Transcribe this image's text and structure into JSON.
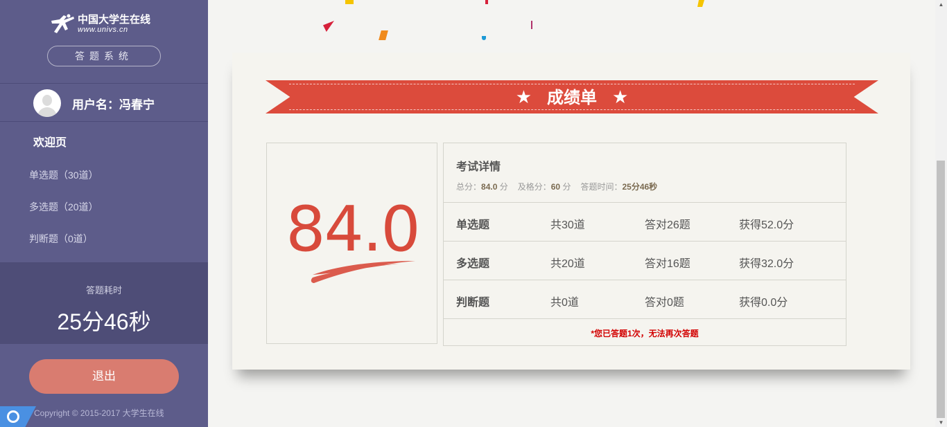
{
  "sidebar": {
    "logo_cn": "中国大学生在线",
    "logo_url": "www.univs.cn",
    "system_label": "答题系统",
    "username_label": "用户名：冯春宁",
    "nav": {
      "welcome": "欢迎页",
      "items": [
        {
          "label": "单选题（30道）"
        },
        {
          "label": "多选题（20道）"
        },
        {
          "label": "判断题（0道）"
        }
      ]
    },
    "timer_label": "答题耗时",
    "timer_value": "25分46秒",
    "logout_label": "退出",
    "copyright": "Copyright © 2015-2017 大学生在线"
  },
  "report": {
    "ribbon_title": "成绩单",
    "score": "84.0",
    "details_title": "考试详情",
    "total_label": "总分：",
    "total_value": "84.0",
    "total_unit": "分",
    "pass_label": "及格分：",
    "pass_value": "60",
    "pass_unit": "分",
    "time_label": "答题时间：",
    "time_value": "25分46秒",
    "rows": [
      {
        "type": "单选题",
        "count": "共30道",
        "correct": "答对26题",
        "points": "获得52.0分"
      },
      {
        "type": "多选题",
        "count": "共20道",
        "correct": "答对16题",
        "points": "获得32.0分"
      },
      {
        "type": "判断题",
        "count": "共0道",
        "correct": "答对0题",
        "points": "获得0.0分"
      }
    ],
    "notice": "*您已答题1次，无法再次答题"
  },
  "colors": {
    "sidebar": "#5d5c8a",
    "accent_red": "#dc4b3c",
    "logout": "#d97c70"
  }
}
